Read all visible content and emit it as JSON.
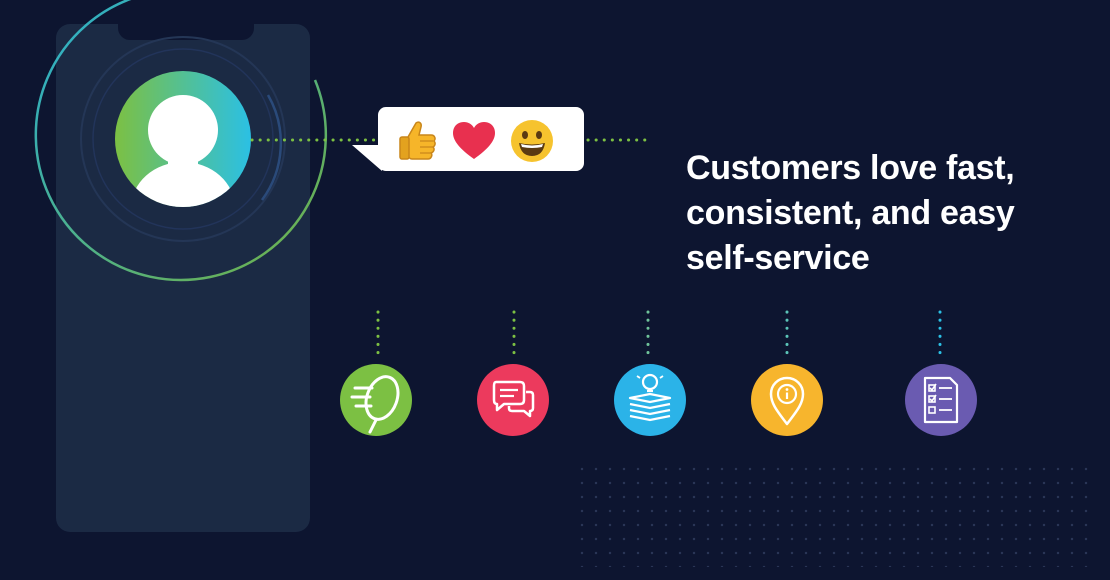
{
  "headline": {
    "lines": [
      "Customers love fast,",
      "consistent, and easy",
      "self-service"
    ]
  },
  "reactions": [
    {
      "icon": "thumbs-up-icon"
    },
    {
      "icon": "heart-icon"
    },
    {
      "icon": "grinning-face-icon"
    }
  ],
  "channels": [
    {
      "icon": "fast-search-icon",
      "color": "#7cc043"
    },
    {
      "icon": "chat-bubbles-icon",
      "color": "#ec3a5d"
    },
    {
      "icon": "knowledge-base-icon",
      "color": "#2bb3e8"
    },
    {
      "icon": "location-info-icon",
      "color": "#f7b52d"
    },
    {
      "icon": "checklist-icon",
      "color": "#6a5bb1"
    }
  ],
  "colors": {
    "background": "#0d1530",
    "phone": "#1b2a44",
    "avatar_gradient_start": "#7cc043",
    "avatar_gradient_end": "#2bc0e4",
    "connector_green": "#7cc043",
    "connector_blue": "#2bc0e4"
  }
}
